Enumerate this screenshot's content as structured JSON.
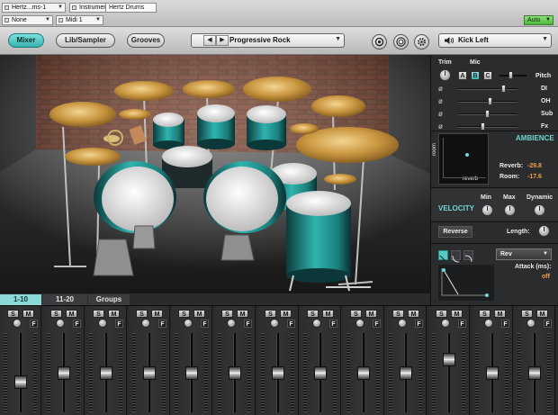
{
  "host": {
    "track_select": "Hertz...ms-1",
    "instrument_type": "Instrument",
    "plugin_name": "Hertz Drums",
    "input_select": "None",
    "midi_select": "Midi 1",
    "auto_label": "Auto"
  },
  "toolbar": {
    "tabs": [
      {
        "label": "Mixer",
        "active": true
      },
      {
        "label": "Lib/Sampler",
        "active": false
      },
      {
        "label": "Grooves",
        "active": false
      }
    ],
    "preset_name": "Progressive Rock",
    "instrument_name": "Kick Left",
    "icons": [
      "record-icon",
      "ring-icon",
      "gear-icon",
      "speaker-icon"
    ]
  },
  "kit_tabs": [
    {
      "label": "1-10",
      "active": true
    },
    {
      "label": "11-20",
      "active": false
    },
    {
      "label": "Groups",
      "active": false
    }
  ],
  "panel": {
    "trim_label": "Trim",
    "mic_label": "Mic",
    "mic_buttons": [
      {
        "label": "A",
        "active": false
      },
      {
        "label": "B",
        "active": true
      },
      {
        "label": "C",
        "active": false
      }
    ],
    "pitch_label": "Pitch",
    "mix_rows": [
      {
        "name": "DI",
        "level": 0.78
      },
      {
        "name": "OH",
        "level": 0.54
      },
      {
        "name": "Sub",
        "level": 0.48
      },
      {
        "name": "Fx",
        "level": 0.4
      }
    ],
    "ambience_label": "AMBIENCE",
    "room_axis": "room",
    "reverb_axis": "reverb",
    "reverb_label": "Reverb:",
    "reverb_value": "-29.8",
    "room_label": "Room:",
    "room_value": "-17.6",
    "velocity_label": "VELOCITY",
    "min_label": "Min",
    "max_label": "Max",
    "dynamic_label": "Dynamic",
    "reverse_label": "Reverse",
    "length_label": "Length:",
    "env_mode": "Rev",
    "attack_label": "Attack (ms):",
    "attack_value": "off"
  },
  "mixer": {
    "solo_label": "S",
    "mute_label": "M",
    "fx_label": "F",
    "channels": [
      {
        "fader": 0.35,
        "highlight": false
      },
      {
        "fader": 0.5,
        "highlight": false
      },
      {
        "fader": 0.5,
        "highlight": false
      },
      {
        "fader": 0.5,
        "highlight": false
      },
      {
        "fader": 0.5,
        "highlight": false
      },
      {
        "fader": 0.5,
        "highlight": false
      },
      {
        "fader": 0.5,
        "highlight": false
      },
      {
        "fader": 0.5,
        "highlight": false
      },
      {
        "fader": 0.5,
        "highlight": false
      },
      {
        "fader": 0.5,
        "highlight": false
      },
      {
        "fader": 0.7,
        "highlight": false
      },
      {
        "fader": 0.5,
        "highlight": false
      },
      {
        "fader": 0.5,
        "highlight": false
      }
    ]
  },
  "colors": {
    "accent": "#6fd6d3",
    "shell": "#2aa6a0",
    "brick": "#6a3524"
  }
}
